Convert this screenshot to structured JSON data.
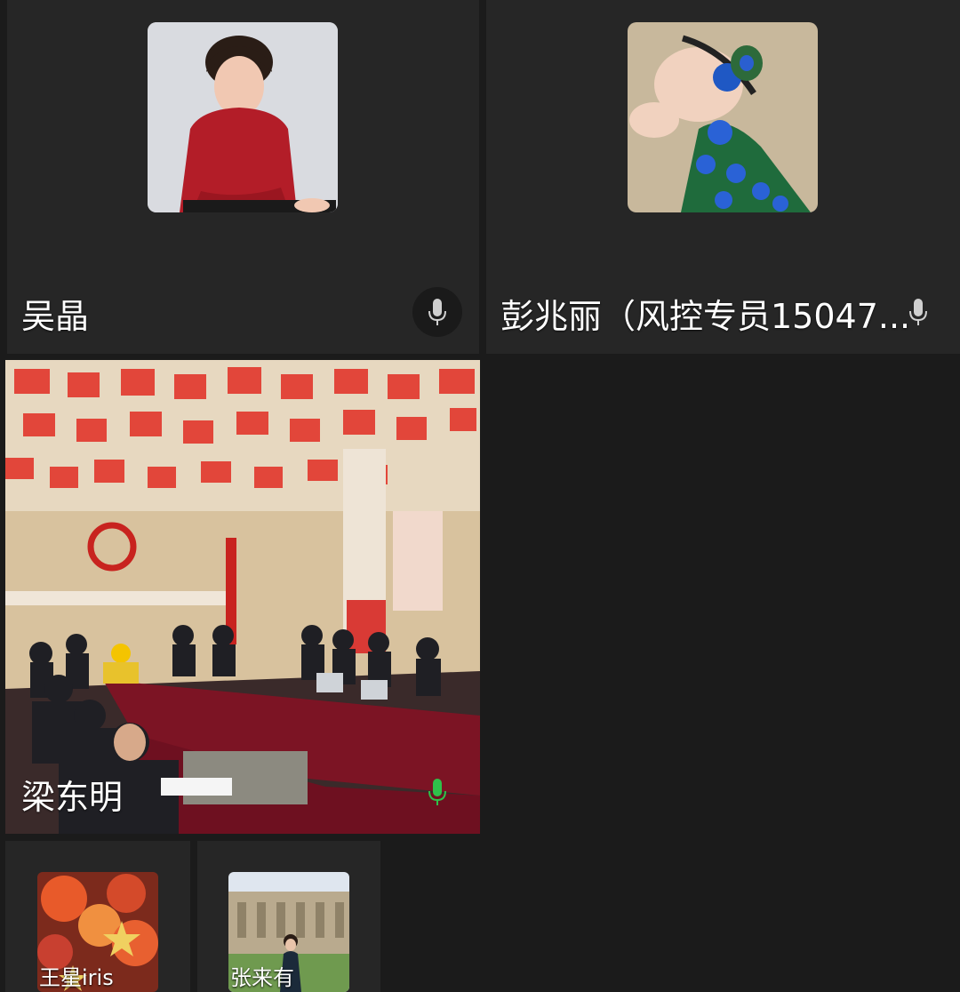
{
  "participants": [
    {
      "name": "吴晶",
      "mic": "muted",
      "avatar": "portrait-woman-red-shirt"
    },
    {
      "name": "彭兆丽（风控专员15047...",
      "mic": "muted",
      "avatar": "baby-peacock-costume"
    },
    {
      "name": "梁东明",
      "mic": "speaking",
      "video": "conference-room-meeting"
    },
    {
      "name": "王星iris",
      "avatar": "red-lanterns"
    },
    {
      "name": "张来有",
      "avatar": "woman-in-front-of-chapel"
    }
  ],
  "colors": {
    "background": "#1b1b1b",
    "tile": "#262626",
    "mic_active": "#2fc14a",
    "mic_muted": "#cfcfcf"
  }
}
